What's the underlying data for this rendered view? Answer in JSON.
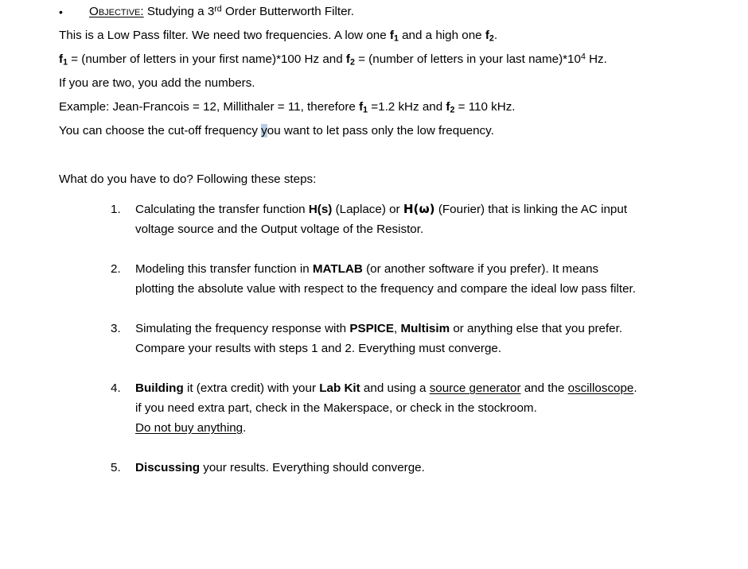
{
  "document": {
    "bullet": {
      "marker": "•",
      "label": "Objective:",
      "text_before_sup": " Studying a 3",
      "sup": "rd",
      "text_after_sup": " Order Butterworth Filter."
    },
    "paragraphs": [
      {
        "name": "para-lowpass",
        "segments": [
          {
            "type": "text",
            "value": "This is a Low Pass filter. We need two frequencies. A low one "
          },
          {
            "type": "bold",
            "value": "f"
          },
          {
            "type": "bold-sub",
            "value": "1"
          },
          {
            "type": "text",
            "value": " and a high one "
          },
          {
            "type": "bold",
            "value": "f"
          },
          {
            "type": "bold-sub",
            "value": "2"
          },
          {
            "type": "text",
            "value": "."
          }
        ],
        "plain": "This is a Low Pass filter. We need two frequencies. A low one f1 and a high one f2."
      },
      {
        "name": "para-formula",
        "plain": "f1 = (number of letters in your first name)*100 Hz and f2 = (number of letters in your last name)*10^4 Hz."
      },
      {
        "name": "para-two-people",
        "plain": "If you are two, you add the numbers."
      },
      {
        "name": "para-example",
        "plain": "Example: Jean-Francois = 12, Millithaler = 11, therefore f1 =1.2 kHz and f2 = 110 kHz."
      },
      {
        "name": "para-cutoff",
        "plain": "You can choose the cut-off frequency you want to let pass only the low frequency."
      }
    ],
    "formula_line": {
      "f_label": "f",
      "sub1": "1",
      "mid1": " = (number of letters in your first name)*100 Hz and ",
      "sub2": "2",
      "mid2": " = (number of letters in your last name)*10",
      "sup": "4",
      "tail": " Hz."
    },
    "two_people_line": "If you are two, you add the numbers.",
    "example_line": {
      "lead": "Example: Jean-Francois = 12, Millithaler = 11, therefore ",
      "f1": "f",
      "sub1": "1",
      "mid": " =1.2 kHz and ",
      "f2": "f",
      "sub2": "2",
      "tail": " = 110 kHz."
    },
    "cutoff_line": {
      "lead": "You can choose the cut-off frequency ",
      "highlight": "y",
      "tail": "ou want to let pass only the low frequency."
    },
    "lowpass_line": {
      "lead": "This is a Low Pass filter. We need two frequencies. A low one ",
      "f1": "f",
      "sub1": "1",
      "mid": " and a high one ",
      "f2": "f",
      "sub2": "2",
      "tail": "."
    },
    "prompt": "What do you have to do? Following these steps:",
    "steps": [
      {
        "number": "1.",
        "name": "step-transfer-function",
        "line1": {
          "a": "Calculating the transfer function ",
          "bold1": "H(s)",
          "b": " (Laplace) or ",
          "bold2": "H(ω)",
          "c": " (Fourier) that is linking the AC input"
        },
        "line2": "voltage source and the Output voltage of the Resistor.",
        "plain": "Calculating the transfer function H(s) (Laplace) or H(ω) (Fourier) that is linking the AC input voltage source and the Output voltage of the Resistor."
      },
      {
        "number": "2.",
        "name": "step-modeling",
        "line1": {
          "a": "Modeling this transfer function in ",
          "bold1": "MATLAB",
          "b": " (or another software if you prefer). It means"
        },
        "line2": "plotting the absolute value with respect to the frequency and compare the ideal low pass filter.",
        "plain": "Modeling this transfer function in MATLAB (or another software if you prefer). It means plotting the absolute value with respect to the frequency and compare the ideal low pass filter."
      },
      {
        "number": "3.",
        "name": "step-simulating",
        "line1": {
          "a": "Simulating the frequency response with ",
          "bold1": "PSPICE",
          "b": ", ",
          "bold2": "Multisim",
          "c": " or anything else that you prefer."
        },
        "line2": "Compare your results with steps 1 and 2. Everything must converge.",
        "plain": "Simulating the frequency response with PSPICE, Multisim or anything else that you prefer. Compare your results with steps 1 and 2. Everything must converge."
      },
      {
        "number": "4.",
        "name": "step-building",
        "line1": {
          "bold1": "Building",
          "a": " it (extra credit) with your ",
          "bold2": "Lab Kit",
          "b": " and using a ",
          "u1": "source generator",
          "c": " and the ",
          "u2": "oscilloscope",
          "d": "."
        },
        "line2": "if you need extra part, check in the Makerspace, or check in the stockroom.",
        "line3": {
          "u1": "Do not buy anything",
          "tail": "."
        },
        "plain": "Building it (extra credit) with your Lab Kit and using a source generator and the oscilloscope. if you need extra part, check in the Makerspace, or check in the stockroom. Do not buy anything."
      },
      {
        "number": "5.",
        "name": "step-discussing",
        "line1": {
          "bold1": "Discussing",
          "a": " your results. Everything should converge."
        },
        "plain": "Discussing your results. Everything should converge."
      }
    ],
    "colors": {
      "text": "#000000",
      "background": "#ffffff",
      "highlight": "#b8cce4"
    }
  }
}
